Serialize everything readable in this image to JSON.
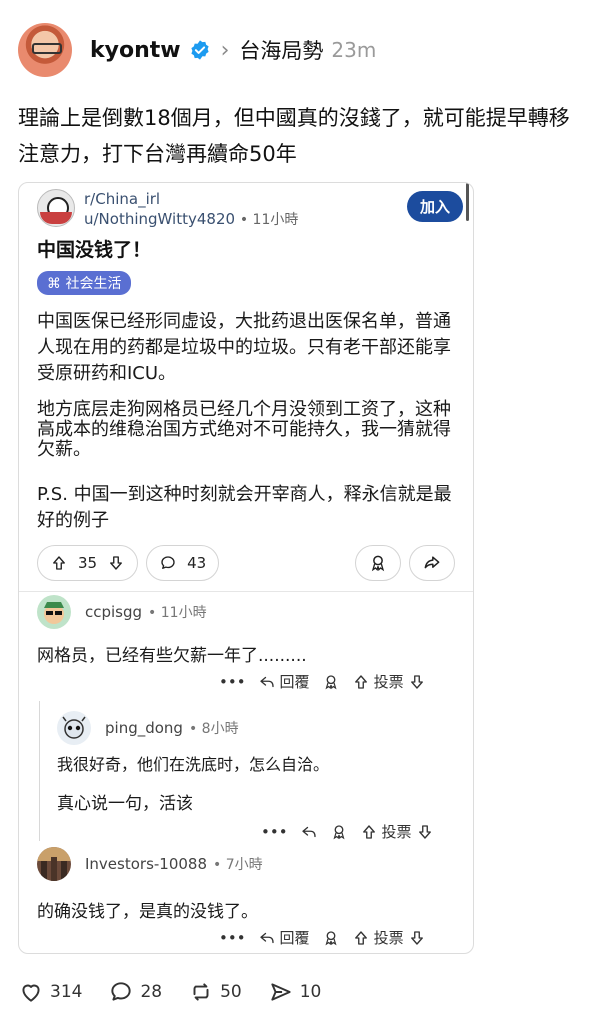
{
  "post": {
    "username": "kyontw",
    "topic": "台海局勢",
    "time": "23m",
    "text": "理論上是倒數18個月，但中國真的沒錢了，就可能提早轉移注意力，打下台灣再續命50年"
  },
  "embed": {
    "subreddit": "r/China_irl",
    "author": "u/NothingWitty4820",
    "time": "11小時",
    "join_label": "加入",
    "title": "中国没钱了！",
    "flair": "社会生活",
    "paragraphs": [
      "中国医保已经形同虚设，大批药退出医保名单，普通人现在用的药都是垃圾中的垃圾。只有老干部还能享受原研药和ICU。",
      "地方底层走狗网格员已经几个月没领到工资了，这种高成本的维稳治国方式绝对不可能持久，我一猜就得欠薪。",
      "P.S. 中国一到这种时刻就会开宰商人，释永信就是最好的例子"
    ],
    "upvotes": "35",
    "comments": "43",
    "reply_label": "回覆",
    "report_label": "投票"
  },
  "comments": [
    {
      "name": "ccpisgg",
      "time": "11小時",
      "text": "网格员，已经有些欠薪一年了........."
    },
    {
      "name": "ping_dong",
      "time": "8小時",
      "text": "我很好奇，他们在洗底时，怎么自洽。",
      "text2": "真心说一句，活该"
    },
    {
      "name": "Investors-10088",
      "time": "7小時",
      "text": "的确没钱了，是真的没钱了。"
    }
  ],
  "footer": {
    "likes": "314",
    "replies": "28",
    "reposts": "50",
    "shares": "10"
  },
  "colors": {
    "join_button": "#1c4c9e",
    "flair": "#5a6fd2",
    "verified": "#1d9bf0"
  }
}
